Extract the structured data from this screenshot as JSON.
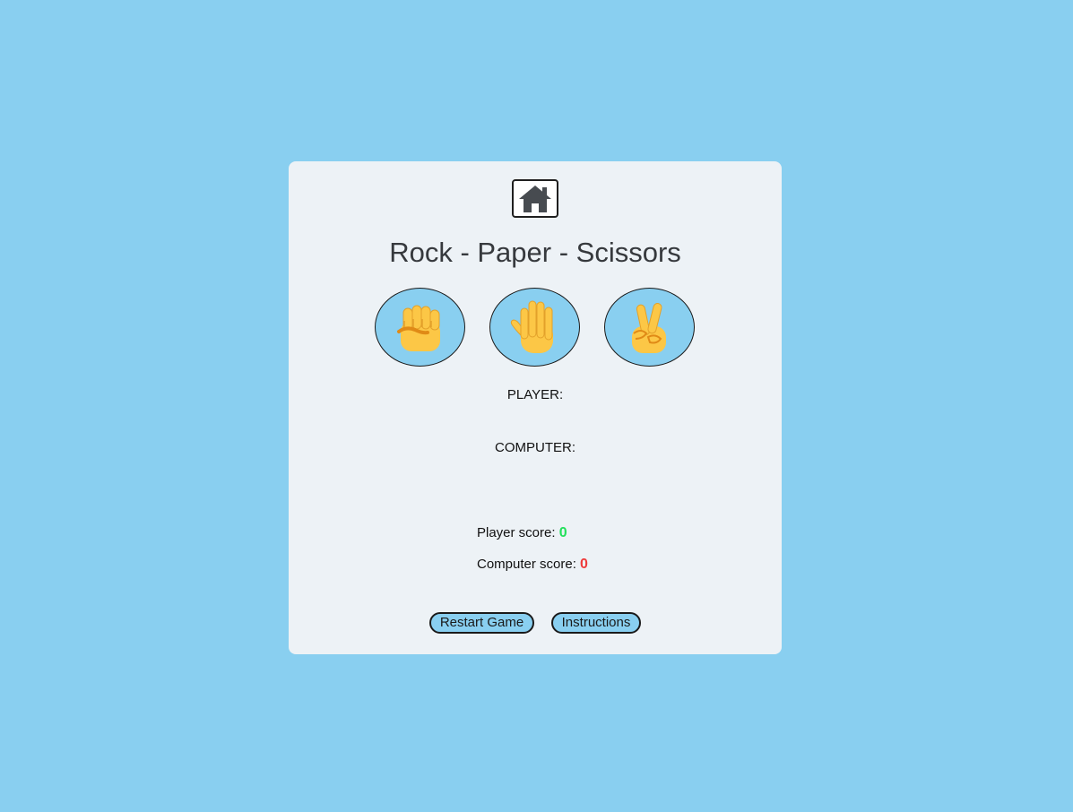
{
  "app": {
    "title": "Rock - Paper - Scissors"
  },
  "home": {
    "icon": "home-icon"
  },
  "choices": [
    {
      "name": "rock",
      "icon": "raised-fist-icon"
    },
    {
      "name": "paper",
      "icon": "raised-hand-icon"
    },
    {
      "name": "scissors",
      "icon": "victory-hand-icon"
    }
  ],
  "labels": {
    "player": "PLAYER:",
    "computer": "COMPUTER:"
  },
  "scores": {
    "player_label": "Player score:",
    "player_value": "0",
    "computer_label": "Computer score:",
    "computer_value": "0"
  },
  "buttons": {
    "restart": "Restart Game",
    "instructions": "Instructions"
  },
  "colors": {
    "background": "#89cff0",
    "card": "#edf2f6",
    "player_score": "#22e05a",
    "computer_score": "#ee3b3b"
  }
}
